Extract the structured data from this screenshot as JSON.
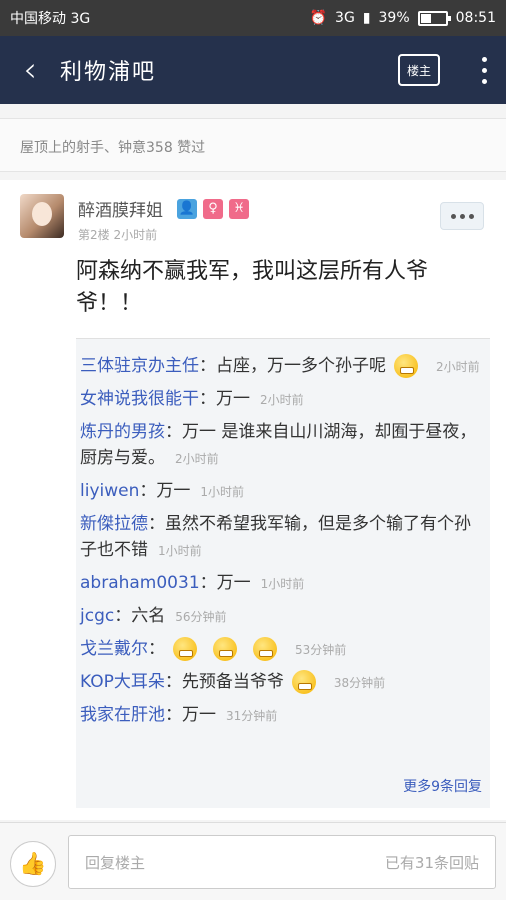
{
  "status_bar": {
    "carrier": "中国移动 3G",
    "network": "3G",
    "battery_percent": "39%",
    "battery_level": 0.39,
    "time": "08:51"
  },
  "app_bar": {
    "back_icon": "chevron-left-icon",
    "title": "利物浦吧",
    "louzhu_label": "楼主",
    "more_icon": "vertical-dots-icon"
  },
  "likes_line": "屋顶上的射手、钟意358 赞过",
  "post": {
    "username": "醉酒膜拜姐",
    "badges": [
      {
        "icon": "user-icon",
        "color": "#4aa3df"
      },
      {
        "icon": "female-icon",
        "color": "#f06b8a"
      },
      {
        "icon": "pisces-icon",
        "color": "#f06b8a"
      }
    ],
    "floor": "第2楼",
    "time": "2小时前",
    "content": "阿森纳不赢我军，我叫这层所有人爷爷！！"
  },
  "replies": [
    {
      "user": "三体驻京办主任",
      "text": "占座，万一多个孙子呢",
      "emoji": "grin-emoji",
      "time": "2小时前"
    },
    {
      "user": "女神说我很能干",
      "text": "万一",
      "time": "2小时前"
    },
    {
      "user": "炼丹的男孩",
      "text": "万一 是谁来自山川湖海，却囿于昼夜，厨房与爱。",
      "time": "2小时前"
    },
    {
      "user": "liyiwen",
      "text": "万一",
      "time": "1小时前"
    },
    {
      "user": "新傑拉德",
      "text": "虽然不希望我军输，但是多个输了有个孙子也不错",
      "time": "1小时前"
    },
    {
      "user": "abraham0031",
      "text": "万一",
      "time": "1小时前"
    },
    {
      "user": "jcgc",
      "text": "六名",
      "time": "56分钟前"
    },
    {
      "user": "戈兰戴尔",
      "text": "",
      "emoji": "grimace-emoji x3",
      "time": "53分钟前"
    },
    {
      "user": "KOP大耳朵",
      "text": "先预备当爷爷",
      "emoji": "angry-emoji",
      "time": "38分钟前"
    },
    {
      "user": "我家在肝池",
      "text": "万一",
      "time": "31分钟前"
    }
  ],
  "more_replies_label": "更多9条回复",
  "bottom_bar": {
    "like_icon": "thumbs-up-icon",
    "reply_placeholder": "回复楼主",
    "reply_count": "已有31条回贴"
  }
}
